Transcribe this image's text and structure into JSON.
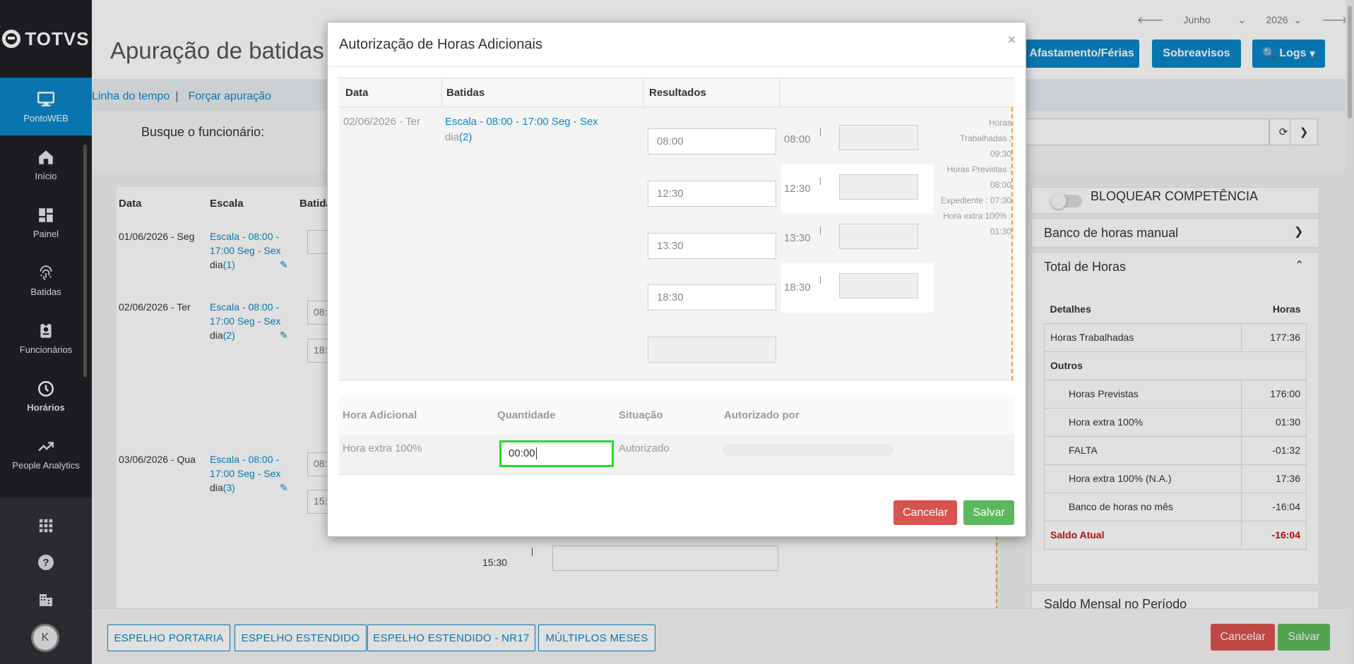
{
  "sidebar": {
    "logo": "TOTVS",
    "items": [
      {
        "label": "PontoWEB",
        "icon": "monitor-icon"
      },
      {
        "label": "Início",
        "icon": "home-icon"
      },
      {
        "label": "Painel",
        "icon": "dashboard-icon"
      },
      {
        "label": "Batidas",
        "icon": "fingerprint-icon"
      },
      {
        "label": "Funcionários",
        "icon": "badge-icon"
      },
      {
        "label": "Horários",
        "icon": "clock-icon"
      },
      {
        "label": "People Analytics",
        "icon": "trend-icon"
      }
    ],
    "avatar": "K"
  },
  "header": {
    "title": "Apuração de batidas",
    "month": "Junho",
    "year": "2026",
    "buttons": {
      "afastamento": "Afastamento/Férias",
      "sobreavisos": "Sobreavisos",
      "logs": "Logs"
    }
  },
  "links": {
    "timeline": "Linha do tempo",
    "sep": "|",
    "force": "Forçar apuração"
  },
  "search": {
    "label": "Busque o funcionário:"
  },
  "grid": {
    "headers": {
      "data": "Data",
      "escala": "Escala",
      "batidas": "Batidas"
    },
    "rows": [
      {
        "date": "01/06/2026 - Seg",
        "escala": "Escala - 08:00 - 17:00 Seg - Sex",
        "dia": "dia",
        "dian": "(1)"
      },
      {
        "date": "02/06/2026 - Ter",
        "escala": "Escala - 08:00 - 17:00 Seg - Sex",
        "dia": "dia",
        "dian": "(2)",
        "in1": "08:",
        "in2": "18:"
      },
      {
        "date": "03/06/2026 - Qua",
        "escala": "Escala - 08:00 - 17:00 Seg - Sex",
        "dia": "dia",
        "dian": "(3)",
        "in1": "08:",
        "in2": "15:"
      }
    ],
    "time_1530": "15:30"
  },
  "right_panel": {
    "lock": "BLOQUEAR COMPETÊNCIA",
    "banco_manual": "Banco de horas manual",
    "total_horas": "Total de Horas",
    "table_head": {
      "detalhes": "Detalhes",
      "horas": "Horas"
    },
    "rows": [
      {
        "label": "Horas Trabalhadas",
        "value": "177:36"
      },
      {
        "label": "Outros",
        "value": ""
      },
      {
        "label": "Horas Previstas",
        "value": "176:00"
      },
      {
        "label": "Hora extra 100%",
        "value": "01:30"
      },
      {
        "label": "FALTA",
        "value": "-01:32"
      },
      {
        "label": "Hora extra 100% (N.A.)",
        "value": "17:36"
      },
      {
        "label": "Banco de horas no mês",
        "value": "-16:04"
      },
      {
        "label": "Saldo Atual",
        "value": "-16:04"
      }
    ],
    "saldo_mensal": "Saldo Mensal no Período"
  },
  "bottom": {
    "buttons": [
      "ESPELHO PORTARIA",
      "ESPELHO ESTENDIDO",
      "ESPELHO ESTENDIDO - NR17",
      "MÚLTIPLOS MESES"
    ],
    "cancel": "Cancelar",
    "save": "Salvar"
  },
  "modal": {
    "title": "Autorização de Horas Adicionais",
    "close": "×",
    "headers": {
      "data": "Data",
      "batidas": "Batidas",
      "resultados": "Resultados"
    },
    "date": "02/06/2026 - Ter",
    "escala": "Escala - 08:00 - 17:00 Seg - Sex",
    "dia": "dia",
    "dian": "(2)",
    "inputs": [
      "08:00",
      "12:30",
      "13:30",
      "18:30"
    ],
    "results": [
      "08:00",
      "12:30",
      "13:30",
      "18:30"
    ],
    "side": {
      "l1": "Horas",
      "l2": "Trabalhadas :",
      "l3": "09:30",
      "l4": "Horas Previstas :",
      "l5": "08:00",
      "l6": "Expediente : 07:30",
      "l7": "Hora extra 100% :",
      "l8": "01:30"
    },
    "foot_headers": {
      "hora": "Hora Adicional",
      "qtd": "Quantidade",
      "sit": "Situação",
      "aut": "Autorizado por"
    },
    "foot_row": {
      "hora": "Hora extra 100%",
      "qtd": "00:00",
      "sit": "Autorizado"
    },
    "cancel": "Cancelar",
    "save": "Salvar"
  },
  "colors": {
    "primary": "#0b86c6",
    "sidebar": "#1f2126",
    "danger": "#d9534f",
    "success": "#5cb85c",
    "focus": "#22dd22"
  }
}
